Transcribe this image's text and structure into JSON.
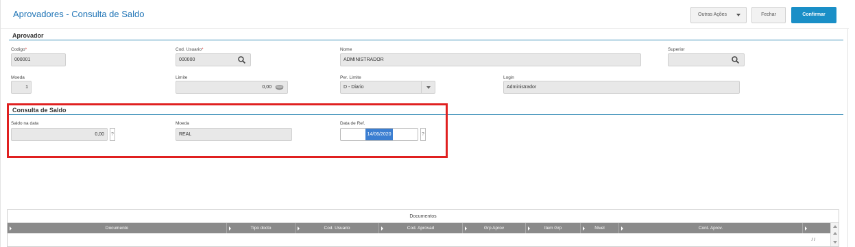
{
  "header": {
    "title": "Aprovadores - Consulta de Saldo",
    "outras_acoes": "Outras Ações",
    "fechar": "Fechar",
    "confirmar": "Confirmar"
  },
  "aprovador": {
    "section_title": "Aprovador",
    "codigo_label": "Codigo",
    "codigo_value": "000001",
    "cod_usuario_label": "Cod. Usuario",
    "cod_usuario_value": "000000",
    "nome_label": "Nome",
    "nome_value": "ADMINISTRADOR",
    "superior_label": "Superior",
    "superior_value": "",
    "moeda_label": "Moeda",
    "moeda_value": "1",
    "limite_label": "Limite",
    "limite_value": "0,00",
    "per_limite_label": "Per. Limite",
    "per_limite_value": "D - Diario",
    "login_label": "Login",
    "login_value": "Administrador",
    "required_mark": "*"
  },
  "consulta": {
    "section_title": "Consulta de Saldo",
    "saldo_label": "Saldo na data",
    "saldo_value": "0,00",
    "moeda_label": "Moeda",
    "moeda_value": "REAL",
    "data_ref_label": "Data de Ref.",
    "data_ref_value": "14/06/2020",
    "help_glyph": "?"
  },
  "grid": {
    "caption": "Documentos",
    "columns": [
      "Documento",
      "Tipo docto",
      "Cod. Usuario",
      "Cod. Aprovad",
      "Grp Aprov",
      "Item Grp",
      "Nivel",
      "Cont. Aprov."
    ],
    "row_date": "/ /"
  },
  "colors": {
    "accent": "#1a8fc7",
    "title": "#1f74b6",
    "highlight": "#e02020",
    "grid_header": "#8a8a8a"
  }
}
